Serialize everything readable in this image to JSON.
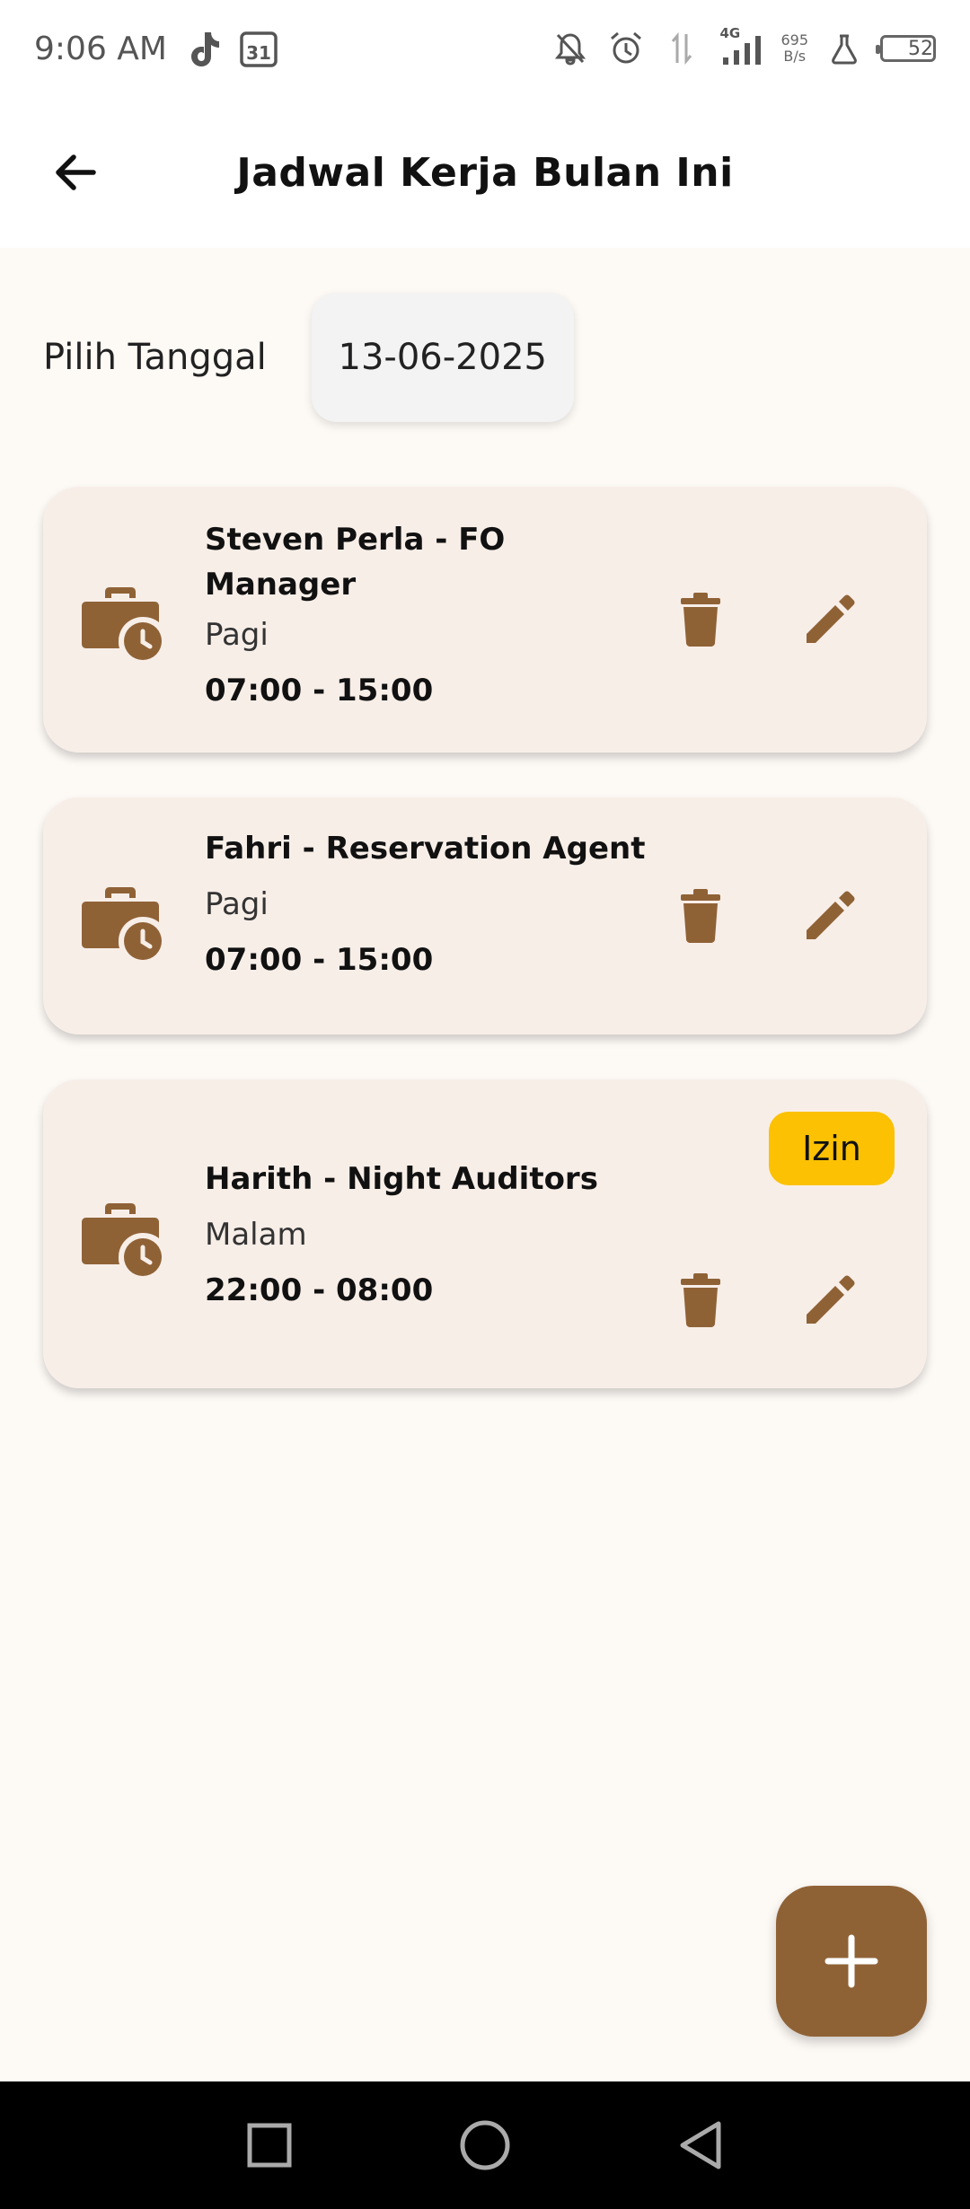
{
  "status_bar": {
    "time": "9:06 AM",
    "calendar_day": "31",
    "network_type": "4G",
    "speed_value": "695",
    "speed_unit": "B/s",
    "battery": "52"
  },
  "app_bar": {
    "title": "Jadwal Kerja Bulan Ini"
  },
  "date_picker": {
    "label": "Pilih Tanggal",
    "value": "13-06-2025"
  },
  "schedules": [
    {
      "name_line1": "Steven Perla - FO",
      "name_line2": "Manager",
      "shift": "Pagi",
      "time": "07:00 - 15:00"
    },
    {
      "name_line1": "Fahri - Reservation Agent",
      "shift": "Pagi",
      "time": "07:00 - 15:00"
    },
    {
      "name_line1": "Harith - Night Auditors",
      "shift": "Malam",
      "time": "22:00 - 08:00",
      "badge": "Izin"
    }
  ],
  "colors": {
    "brand": "#8f6236",
    "card_bg": "#f8eee8",
    "badge_bg": "#fbc102",
    "page_bg": "#fdf9f5"
  },
  "icons": {
    "card": "work-history-icon",
    "delete": "trash-icon",
    "edit": "pencil-icon",
    "fab": "plus-icon"
  }
}
